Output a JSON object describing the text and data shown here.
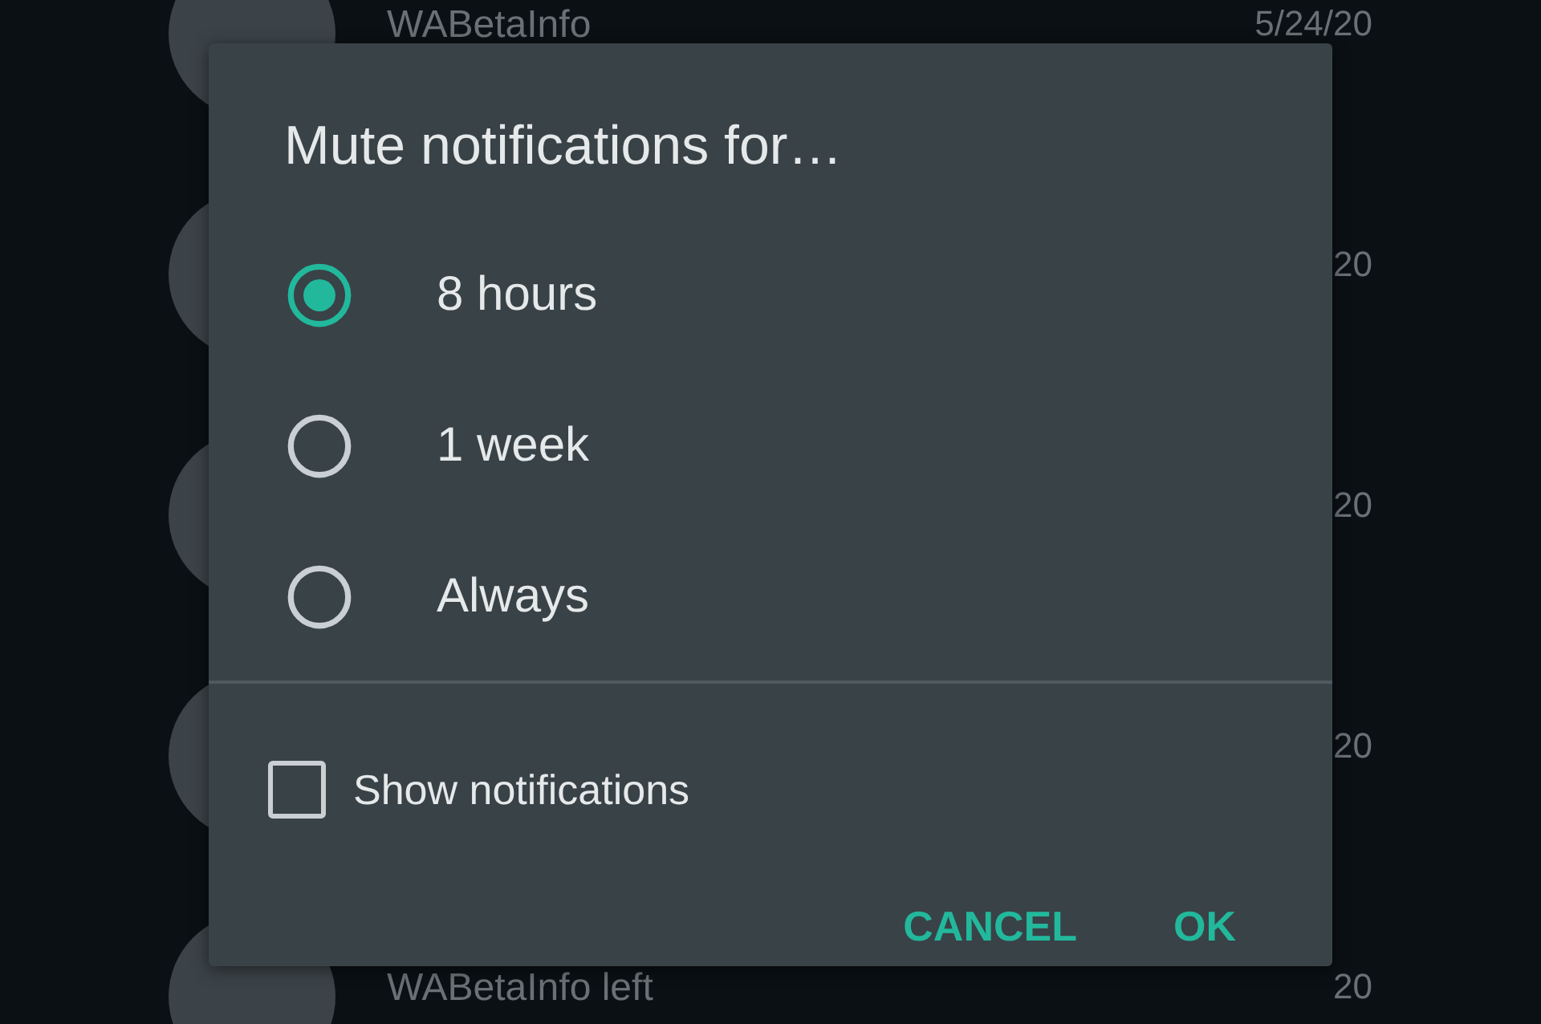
{
  "chat_list": [
    {
      "name": "WABetaInfo",
      "date": "5/24/20"
    },
    {
      "date": "20"
    },
    {
      "date": "20"
    },
    {
      "date": "20"
    },
    {
      "name": "WABetaInfo left",
      "date": "20"
    }
  ],
  "dialog": {
    "title": "Mute notifications for…",
    "options": [
      {
        "label": "8 hours",
        "selected": true
      },
      {
        "label": "1 week",
        "selected": false
      },
      {
        "label": "Always",
        "selected": false
      }
    ],
    "show_notifications": {
      "label": "Show notifications",
      "checked": false
    },
    "buttons": [
      "CANCEL",
      "OK"
    ]
  }
}
